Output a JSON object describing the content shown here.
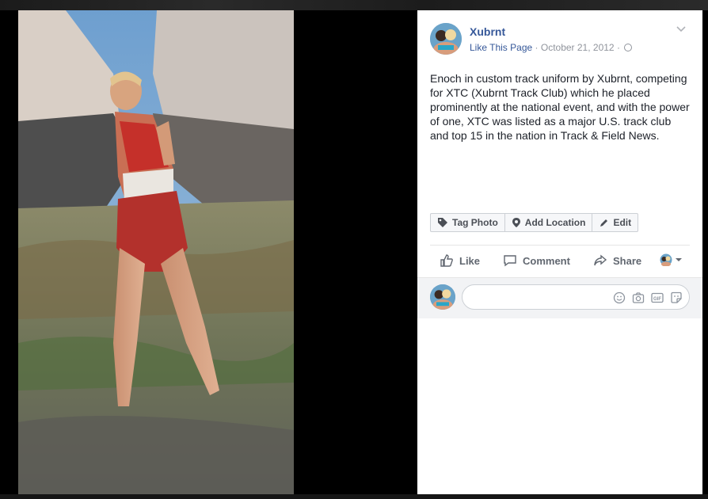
{
  "post": {
    "page_name": "Xubrnt",
    "like_page": "Like This Page",
    "meta_sep": "·",
    "date": "October 21, 2012",
    "caption": "Enoch in custom track uniform by Xubrnt, competing for XTC (Xubrnt Track Club) which he placed prominently at the national event, and with the power of one, XTC was listed as a major U.S. track club and top 15 in the nation in Track & Field News."
  },
  "photo_actions": {
    "tag_photo": "Tag Photo",
    "add_location": "Add Location",
    "edit": "Edit"
  },
  "feedback": {
    "like": "Like",
    "comment": "Comment",
    "share": "Share"
  },
  "comment_box": {
    "placeholder": ""
  },
  "colors": {
    "link": "#365899",
    "meta": "#90949c",
    "text": "#1d2129",
    "shorts": "#c0392b"
  },
  "icons": [
    "chevron-down-icon",
    "globe-icon",
    "tag-icon",
    "location-pin-icon",
    "pencil-icon",
    "thumbs-up-icon",
    "comment-bubble-icon",
    "share-arrow-icon",
    "emoji-icon",
    "camera-icon",
    "gif-icon",
    "sticker-icon"
  ]
}
